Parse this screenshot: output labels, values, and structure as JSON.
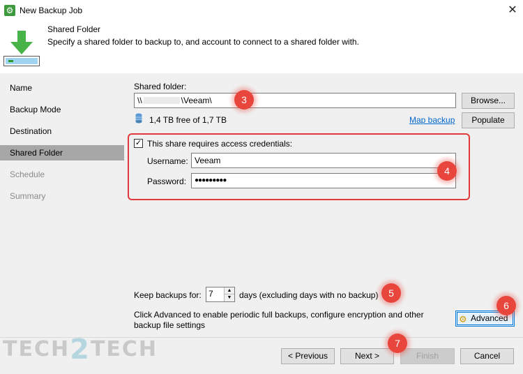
{
  "window": {
    "title": "New Backup Job",
    "close_glyph": "✕"
  },
  "header": {
    "title": "Shared Folder",
    "description": "Specify a shared folder to backup to, and account to connect to a shared folder with.",
    "icon": "download-arrow-icon"
  },
  "sidebar": {
    "items": [
      {
        "label": "Name",
        "state": "normal"
      },
      {
        "label": "Backup Mode",
        "state": "normal"
      },
      {
        "label": "Destination",
        "state": "normal"
      },
      {
        "label": "Shared Folder",
        "state": "active"
      },
      {
        "label": "Schedule",
        "state": "disabled"
      },
      {
        "label": "Summary",
        "state": "disabled"
      }
    ]
  },
  "shared_folder": {
    "label": "Shared folder:",
    "value_prefix": "\\\\",
    "value_suffix": "\\Veeam\\",
    "browse_label": "Browse...",
    "space_text": "1,4 TB free of 1,7 TB",
    "map_backup_label": "Map backup",
    "populate_label": "Populate"
  },
  "credentials": {
    "checkbox_label": "This share requires access credentials:",
    "checked": true,
    "username_label": "Username:",
    "username_value": "Veeam",
    "password_label": "Password:",
    "password_value": "●●●●●●●●●"
  },
  "retention": {
    "keep_label": "Keep backups for:",
    "days_value": "7",
    "days_suffix": "days (excluding days with no backup)"
  },
  "advanced": {
    "hint": "Click Advanced to enable periodic full backups, configure encryption and other backup file settings",
    "button_label": "Advanced"
  },
  "footer": {
    "previous_label": "< Previous",
    "next_label": "Next >",
    "finish_label": "Finish",
    "cancel_label": "Cancel"
  },
  "callouts": [
    "3",
    "4",
    "5",
    "6",
    "7"
  ],
  "watermark": {
    "left": "TECH",
    "middle": "2",
    "right": "TECH"
  },
  "colors": {
    "callout": "#e8453c",
    "active_nav": "#a7a7a7",
    "link": "#0066cc",
    "focus": "#0078d7"
  }
}
